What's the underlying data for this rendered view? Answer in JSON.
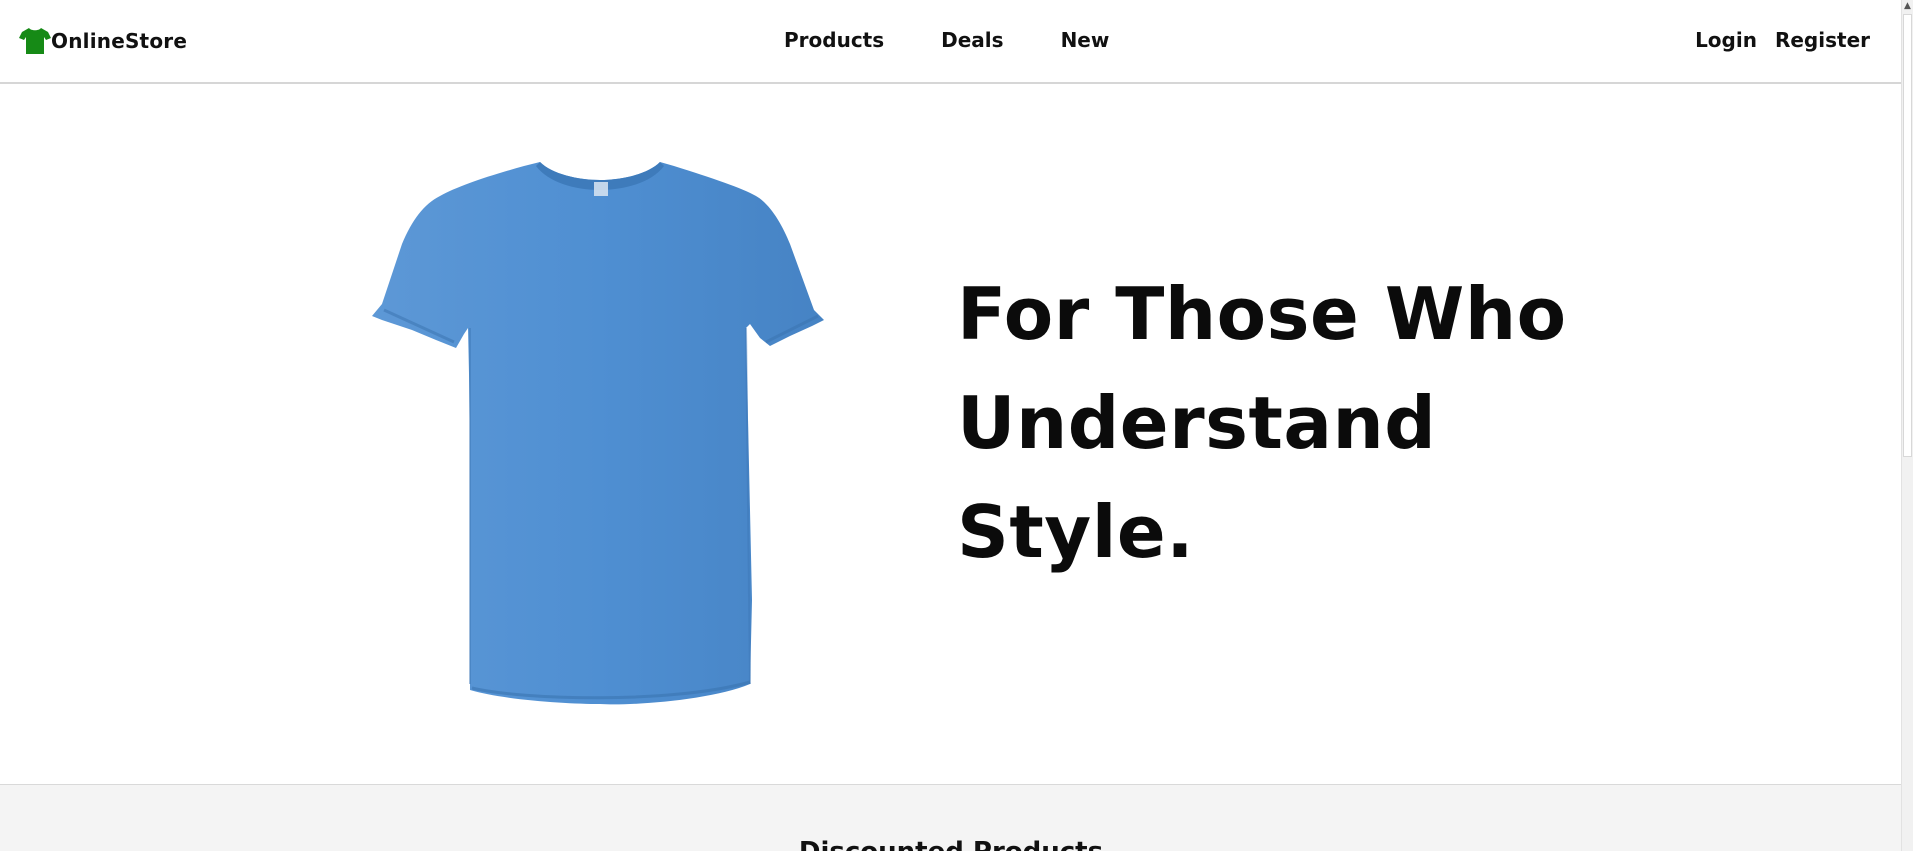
{
  "header": {
    "brand_name": "OnlineStore",
    "brand_icon": "tshirt-icon",
    "brand_color": "#168a16",
    "nav": {
      "products": "Products",
      "deals": "Deals",
      "new": "New"
    },
    "auth": {
      "login": "Login",
      "register": "Register"
    }
  },
  "hero": {
    "headline_line1": "For Those Who",
    "headline_line2": "Understand",
    "headline_line3": "Style.",
    "image": "blue-tshirt-image",
    "shirt_color": "#4b8ccf"
  },
  "discounted": {
    "title": "Discounted Products"
  }
}
